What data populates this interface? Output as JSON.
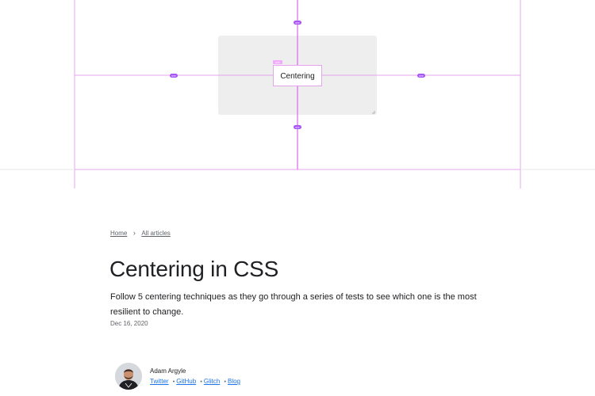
{
  "hero": {
    "demo_label": "Centering",
    "badges": [
      "gap",
      "gap",
      "gap",
      "gap",
      "gap"
    ],
    "accent_color": "#d946ef",
    "badge_color": "#a855f7",
    "panel_color": "#eeeeee"
  },
  "breadcrumb": {
    "home": "Home",
    "separator": "›",
    "all_articles": "All articles"
  },
  "article": {
    "title": "Centering in CSS",
    "subtitle": "Follow 5 centering techniques as they go through a series of tests to see which one is the most resilient to change.",
    "date": "Dec 16, 2020"
  },
  "author": {
    "name": "Adam Argyle",
    "links": [
      "Twitter",
      "GitHub",
      "Glitch",
      "Blog"
    ],
    "separator": "•"
  }
}
